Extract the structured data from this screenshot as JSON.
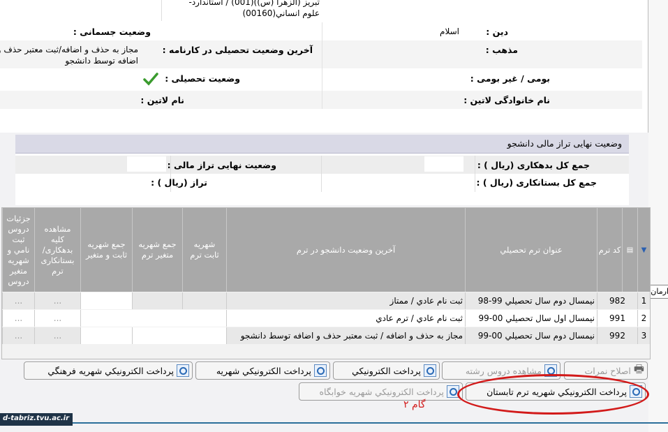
{
  "top": {
    "univ_line1": "تبريز (الزهرا (س))(001) / استاندارد-",
    "univ_line2": "علوم انساني(00160)",
    "physical_status_label": "وضعیت جسمانی :",
    "religion_label": "دین :",
    "religion_value": "اسلام",
    "last_status_label": "آخرین وضعیت تحصیلی در کارنامه :",
    "last_status_value_1": "مجاز به حذف و اضافه/ثبت معتبر حذف و",
    "last_status_value_2": "اضافه توسط دانشجو",
    "sect_label": "مذهب :",
    "edu_status_label": "وضعیت تحصیلی :",
    "native_label": "بومی / غیر بومی :",
    "latin_name_label": "نام لاتین :",
    "latin_family_label": "نام خانوادگی لاتین :"
  },
  "finance": {
    "title": "وضعیت نهایی تراز مالی دانشجو",
    "final_balance_label": "وضعیت نهایی تراز مالی :",
    "total_debit_label": "جمع کل بدهکاری (ریال ) :",
    "balance_label": "تراز (ریال ) :",
    "total_credit_label": "جمع کل بستانکاری (ریال ) :"
  },
  "table": {
    "headers": {
      "code": "کد ترم",
      "title": "عنوان ترم تحصيلي",
      "last_status": "آخرين وضعيت دانشجو در ترم",
      "fixed_fee": "شهريه ثابت ترم",
      "variable_fee": "جمع شهريه متغير ترم",
      "sum_fee": "جمع شهريه ثابت و متغير",
      "view_all": "مشاهده کليه بدهکاری/ بستانکاری ترم",
      "details": "جزئيات دروس ثبت نامي و شهريه متغير دروس"
    },
    "rows": [
      {
        "idx": "1",
        "code": "982",
        "title": "نيمسال دوم سال تحصيلي 99-98",
        "status": "ثبت نام عادي / ممتاز",
        "dots1": "...",
        "dots2": "..."
      },
      {
        "idx": "2",
        "code": "991",
        "title": "نيمسال اول سال تحصيلي 00-99",
        "status": "ثبت نام عادي / ترم عادي",
        "dots1": "...",
        "dots2": "..."
      },
      {
        "idx": "3",
        "code": "992",
        "title": "نيمسال دوم سال تحصيلي 00-99",
        "status": "مجاز به حذف و اضافه / ثبت معتبر حذف و اضافه توسط دانشجو",
        "dots1": "...",
        "dots2": "..."
      }
    ]
  },
  "buttons": {
    "grades": "اصلاح نمرات",
    "field_courses": "مشاهده دروس رشته",
    "e_payment": "پرداخت الكترونيكي",
    "e_tuition": "پرداخت الكترونيكي شهريه",
    "e_cultural": "پرداخت الكترونيكي شهريه فرهنگي",
    "e_summer": "پرداخت الكترونيكي شهريه ترم تابستان",
    "e_dorm": "پرداخت الكترونيكي شهريه خوابگاه"
  },
  "annotation": {
    "step": "گام ۲"
  },
  "footer": {
    "site": "d-tabriz.tvu.ac.ir"
  },
  "tooltip": "ارمان"
}
